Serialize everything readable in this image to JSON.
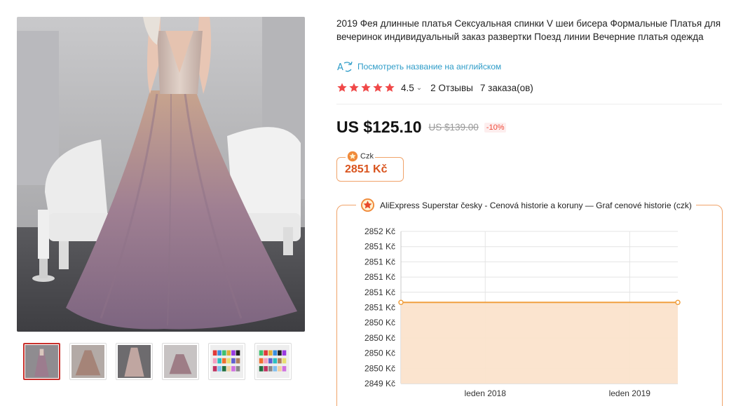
{
  "product": {
    "title": "2019 Фея длинные платья Сексуальная спинки V шеи бисера Формальные Платья для вечеринок индивидуальный заказ развертки Поезд линии Вечерние платья одежда",
    "translate_link": "Посмотреть название на английском",
    "rating": "4.5",
    "reviews": "2 Отзывы",
    "orders": "7 заказа(ов)",
    "price": "US $125.10",
    "old_price": "US $139.00",
    "discount": "-10%"
  },
  "colors": {
    "accent": "#f0a36a",
    "star": "#f04848",
    "price_czk": "#d9541e",
    "link": "#2e9cc8",
    "series": "#f0a040"
  },
  "thumbnails": [
    {
      "icon": "dress-photo-1"
    },
    {
      "icon": "dress-photo-2"
    },
    {
      "icon": "dress-photo-3"
    },
    {
      "icon": "dress-photo-4"
    },
    {
      "icon": "color-chart-1"
    },
    {
      "icon": "color-chart-2"
    }
  ],
  "czk_box": {
    "label": "Czk",
    "value": "2851 Kč"
  },
  "history": {
    "title": "AliExpress Superstar česky - Cenová historie a koruny — Graf cenové historie (czk)"
  },
  "chart_data": {
    "type": "area",
    "y_tick_labels": [
      "2852 Kč",
      "2851 Kč",
      "2851 Kč",
      "2851 Kč",
      "2851 Kč",
      "2851 Kč",
      "2850 Kč",
      "2850 Kč",
      "2850 Kč",
      "2850 Kč",
      "2849 Kč"
    ],
    "x_tick_labels": [
      "leden 2018",
      "leden 2019"
    ],
    "x": [
      "2017-06",
      "2019-05"
    ],
    "values": [
      2850.6,
      2850.6
    ],
    "ylim": [
      2849,
      2852
    ],
    "xlim": [
      "2017-06",
      "2019-05"
    ],
    "grid": true,
    "legend": "none"
  }
}
